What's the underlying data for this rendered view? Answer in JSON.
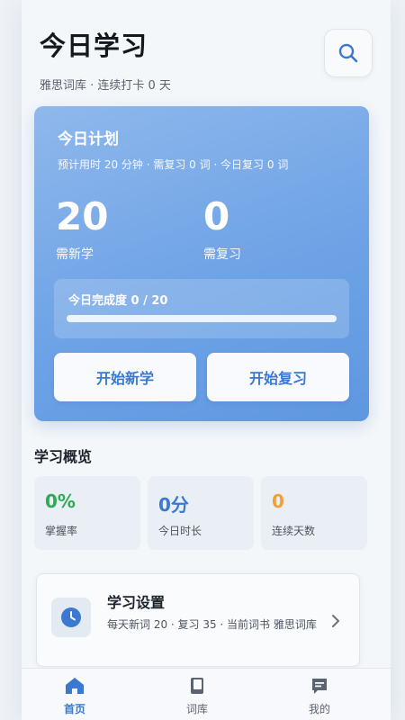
{
  "header": {
    "title": "今日学习",
    "subtitle": "雅思词库 · 连续打卡 0 天"
  },
  "icons": {
    "search": "search-icon",
    "clock": "clock-icon",
    "chevron": "chevron-right-icon",
    "home": "home-icon",
    "book": "book-icon",
    "profile": "profile-icon"
  },
  "plan": {
    "title": "今日计划",
    "description": "预计用时 20 分钟 · 需复习 0 词 · 今日复习 0 词",
    "new_count": "20",
    "new_label": "需新学",
    "review_count": "0",
    "review_label": "需复习",
    "progress_label": "今日完成度 0 / 20",
    "progress_fraction": 0,
    "start_new_label": "开始新学",
    "start_review_label": "开始复习"
  },
  "overview": {
    "title": "学习概览",
    "cards": [
      {
        "value": "0%",
        "label": "掌握率",
        "color": "#2eaa55"
      },
      {
        "value": "0分",
        "label": "今日时长",
        "color": "#3a79cf"
      },
      {
        "value": "0",
        "label": "连续天数",
        "color": "#f0a030"
      }
    ]
  },
  "settings": {
    "title": "学习设置",
    "description": "每天新词 20 · 复习 35 · 当前词书 雅思词库"
  },
  "tabs": [
    {
      "label": "首页",
      "active": true
    },
    {
      "label": "词库",
      "active": false
    },
    {
      "label": "我的",
      "active": false
    }
  ],
  "colors": {
    "accent": "#3a79cf",
    "card_gradient_start": "#8fb8ec",
    "card_gradient_end": "#5f97e0"
  }
}
